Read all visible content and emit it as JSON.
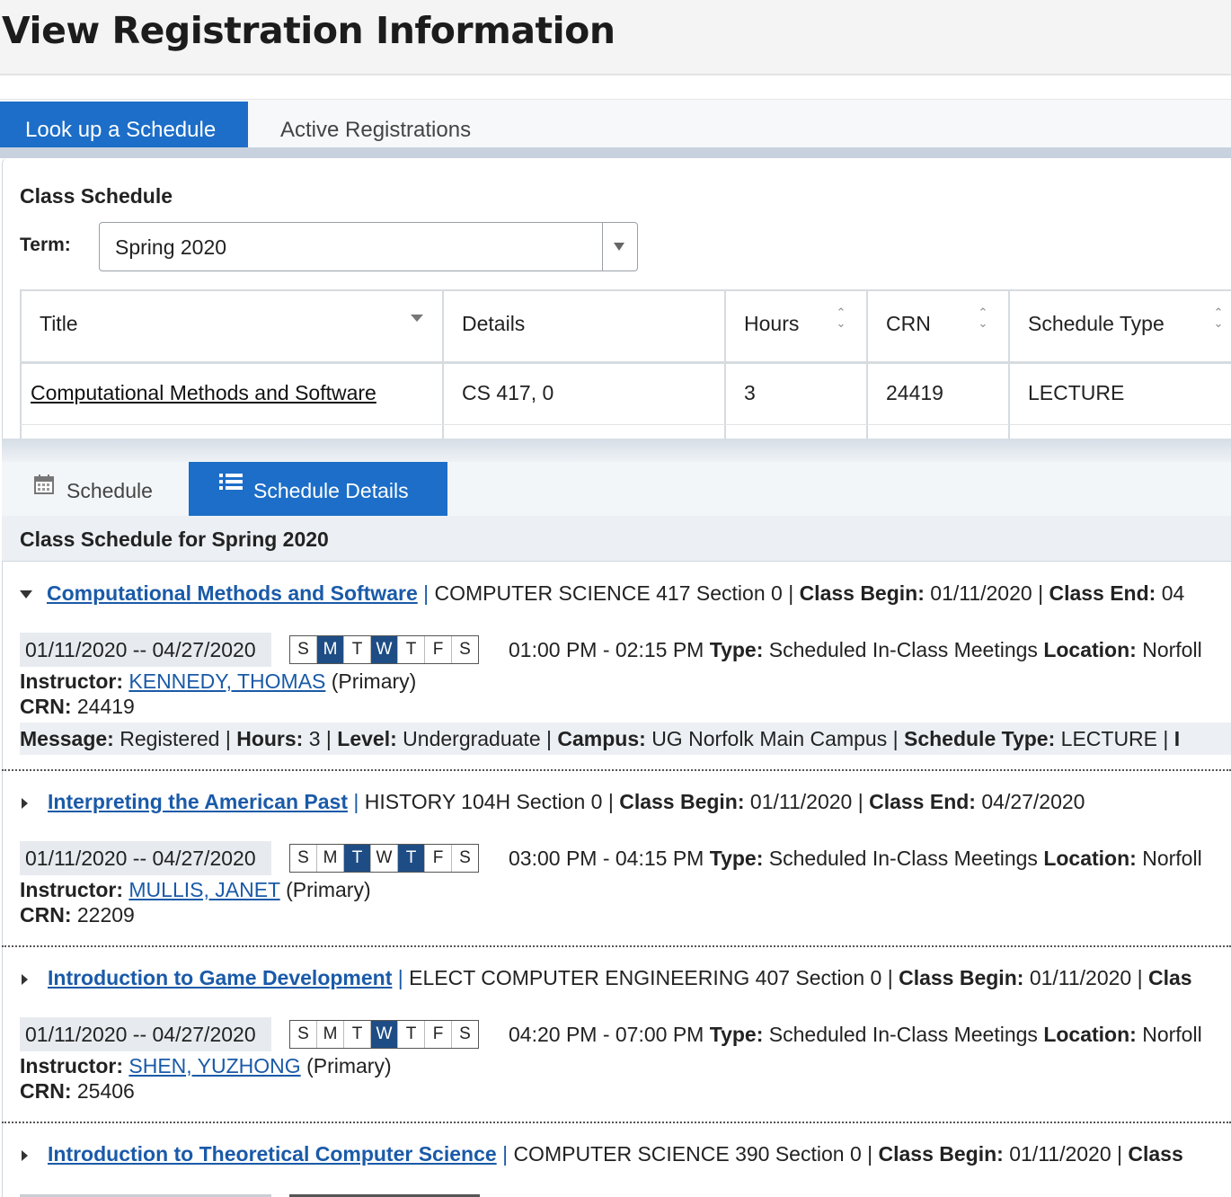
{
  "page": {
    "title": "View Registration Information"
  },
  "tabs": [
    {
      "label": "Look up a Schedule",
      "active": true
    },
    {
      "label": "Active Registrations",
      "active": false
    }
  ],
  "class_schedule": {
    "heading": "Class Schedule",
    "term_label": "Term:",
    "term_value": "Spring 2020"
  },
  "grid": {
    "columns": [
      "Title",
      "Details",
      "Hours",
      "CRN",
      "Schedule Type"
    ],
    "rows": [
      {
        "title": "Computational Methods and Software",
        "details": "CS 417, 0",
        "hours": "3",
        "crn": "24419",
        "schedule_type": "LECTURE"
      }
    ]
  },
  "sub_tabs": [
    {
      "label": "Schedule",
      "icon": "calendar-icon",
      "active": false
    },
    {
      "label": "Schedule Details",
      "icon": "list-icon",
      "active": true
    }
  ],
  "details_header": "Class Schedule for Spring 2020",
  "labels": {
    "class_begin": "Class Begin:",
    "class_end": "Class End:",
    "type": "Type:",
    "location": "Location:",
    "instructor": "Instructor:",
    "crn": "CRN:",
    "primary": "(Primary)",
    "message": "Message:",
    "hours": "Hours:",
    "level": "Level:",
    "campus": "Campus:",
    "schedule_type": "Schedule Type:",
    "pipe": "|"
  },
  "courses": [
    {
      "title": "Computational Methods and Software",
      "subject_section": "COMPUTER SCIENCE 417 Section 0",
      "class_begin": "01/11/2020",
      "class_end": "04",
      "date_range": "01/11/2020 -- 04/27/2020",
      "days": [
        "S",
        "M",
        "T",
        "W",
        "T",
        "F",
        "S"
      ],
      "active_days": [
        1,
        3
      ],
      "time": "01:00 PM - 02:15 PM",
      "type": "Scheduled In-Class Meetings",
      "location": "Norfoll",
      "instructor": "KENNEDY, THOMAS",
      "crn": "24419",
      "message": "Registered",
      "hours": "3",
      "level": "Undergraduate",
      "campus": "UG Norfolk Main Campus",
      "schedule_type": "LECTURE",
      "trailing": "I",
      "expanded": true
    },
    {
      "title": "Interpreting the American Past",
      "subject_section": "HISTORY 104H Section 0",
      "class_begin": "01/11/2020",
      "class_end": "04/27/2020",
      "date_range": "01/11/2020 -- 04/27/2020",
      "days": [
        "S",
        "M",
        "T",
        "W",
        "T",
        "F",
        "S"
      ],
      "active_days": [
        2,
        4
      ],
      "time": "03:00 PM - 04:15 PM",
      "type": "Scheduled In-Class Meetings",
      "location": "Norfoll",
      "instructor": "MULLIS, JANET",
      "crn": "22209",
      "expanded": false
    },
    {
      "title": "Introduction to Game Development",
      "subject_section": "ELECT COMPUTER ENGINEERING 407 Section 0",
      "class_begin": "01/11/2020",
      "class_end_label_partial": "Clas",
      "date_range": "01/11/2020 -- 04/27/2020",
      "days": [
        "S",
        "M",
        "T",
        "W",
        "T",
        "F",
        "S"
      ],
      "active_days": [
        3
      ],
      "time": "04:20 PM - 07:00 PM",
      "type": "Scheduled In-Class Meetings",
      "location": "Norfoll",
      "instructor": "SHEN, YUZHONG",
      "crn": "25406",
      "expanded": false
    },
    {
      "title": "Introduction to Theoretical Computer Science",
      "subject_section": "COMPUTER SCIENCE 390 Section 0",
      "class_begin": "01/11/2020",
      "class_end_label_partial": "Class",
      "expanded": false
    }
  ]
}
